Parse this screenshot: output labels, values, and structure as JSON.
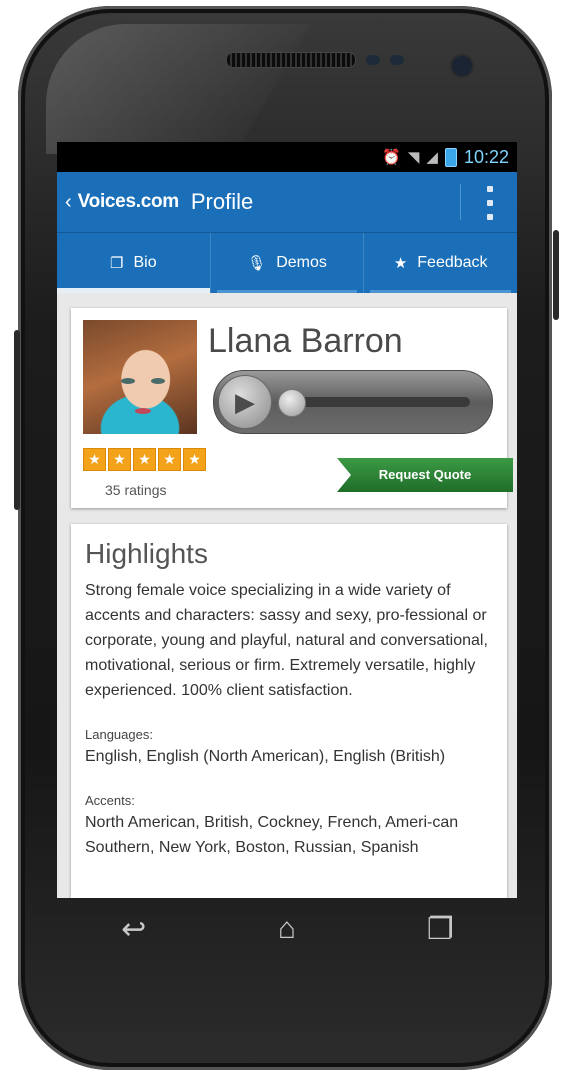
{
  "status": {
    "time": "10:22"
  },
  "actionbar": {
    "logo": "Voices.com",
    "title": "Profile"
  },
  "tabs": [
    {
      "label": "Bio",
      "icon": "document-icon",
      "active": true
    },
    {
      "label": "Demos",
      "icon": "microphone-icon",
      "active": false
    },
    {
      "label": "Feedback",
      "icon": "star-icon",
      "active": false
    }
  ],
  "profile": {
    "name": "Llana Barron",
    "rating_stars": 5,
    "ratings_count": "35 ratings",
    "request_quote_label": "Request Quote"
  },
  "highlights": {
    "title": "Highlights",
    "text": "Strong female voice specializing in a wide variety of accents and characters: sassy and sexy, pro-fessional or corporate, young and playful, natural and conversational, motivational, serious or firm. Extremely versatile, highly experienced. 100% client satisfaction.",
    "languages_label": "Languages:",
    "languages": "English, English (North American), English (British)",
    "accents_label": "Accents:",
    "accents": "North American, British, Cockney, French, Ameri-can Southern, New York, Boston, Russian, Spanish"
  },
  "colors": {
    "actionbar": "#1a6fb8",
    "quote_button": "#2a8a36",
    "star": "#f4a21a"
  }
}
